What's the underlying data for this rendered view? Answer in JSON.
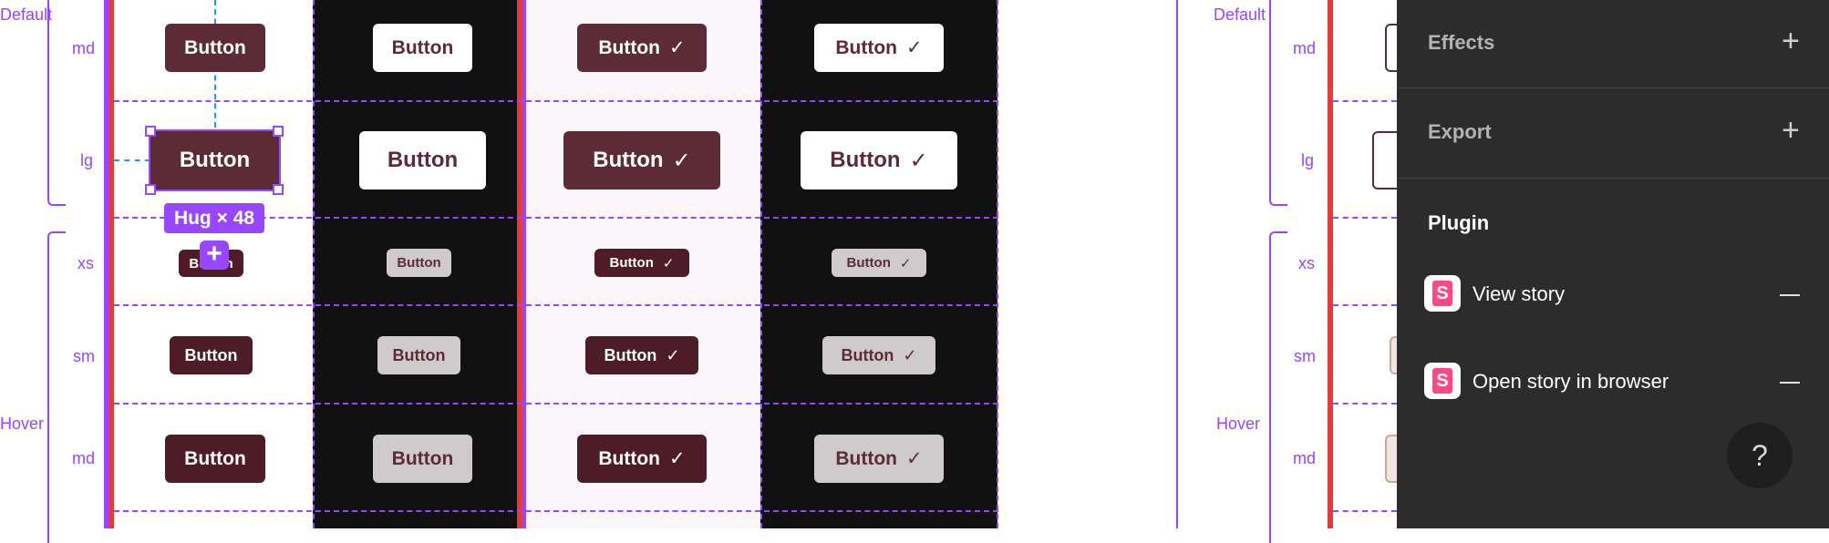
{
  "labels": {
    "default": "Default",
    "hover": "Hover",
    "md": "md",
    "lg": "lg",
    "xs": "xs",
    "sm": "sm"
  },
  "button_text": "Button",
  "check_glyph": "✓",
  "hug_badge": "Hug × 48",
  "panel": {
    "effects": "Effects",
    "export": "Export",
    "plugin": "Plugin",
    "view_story": "View story",
    "open_story": "Open story in browser",
    "help": "?"
  },
  "colors": {
    "accent_purple": "#9747ff",
    "red_frame": "#e03c3c",
    "brand_dark": "#5c2b36",
    "panel_bg": "#2c2c2c",
    "storybook_pink": "#ff4785"
  }
}
